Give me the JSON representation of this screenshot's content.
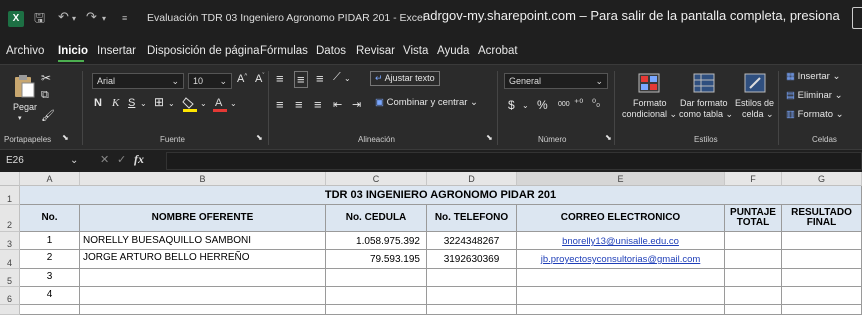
{
  "titlebar": {
    "doc_title": "Evaluación TDR 03 Ingeniero Agronomo PIDAR 201  -  Excel",
    "fullscreen_msg": "adrgov-my.sharepoint.com – Para salir de la pantalla completa, presiona"
  },
  "menu": [
    "Archivo",
    "Inicio",
    "Insertar",
    "Disposición de página",
    "Fórmulas",
    "Datos",
    "Revisar",
    "Vista",
    "Ayuda",
    "Acrobat"
  ],
  "ribbon": {
    "clipboard": {
      "paste": "Pegar",
      "label": "Portapapeles"
    },
    "font": {
      "name": "Arial",
      "size": "10",
      "label": "Fuente",
      "bold": "N",
      "italic": "K",
      "underline": "S"
    },
    "alignment": {
      "wrap": "Ajustar texto",
      "merge": "Combinar y centrar",
      "label": "Alineación"
    },
    "number": {
      "format": "General",
      "currency": "$",
      "percent": "%",
      "thousands": "000",
      "label": "Número"
    },
    "styles": {
      "conditional": "Formato",
      "conditional2": "condicional",
      "as_table": "Dar formato",
      "as_table2": "como tabla",
      "cell_styles": "Estilos de",
      "cell_styles2": "celda",
      "label": "Estilos"
    },
    "cells": {
      "insert": "Insertar",
      "delete": "Eliminar",
      "format": "Formato",
      "label": "Celdas"
    }
  },
  "formula": {
    "name_box": "E26",
    "content": ""
  },
  "columns": [
    "A",
    "B",
    "C",
    "D",
    "E",
    "F",
    "G"
  ],
  "rows": [
    "1",
    "2",
    "3",
    "4",
    "5",
    "6"
  ],
  "sheet": {
    "title": "TDR 03 INGENIERO AGRONOMO PIDAR 201",
    "headers": [
      "No.",
      "NOMBRE OFERENTE",
      "No. CEDULA",
      "No. TELEFONO",
      "CORREO ELECTRONICO",
      "PUNTAJE TOTAL",
      "RESULTADO FINAL"
    ],
    "data": [
      [
        "1",
        "NORELLY BUESAQUILLO SAMBONI",
        "1.058.975.392",
        "3224348267",
        "bnorelly13@unisalle.edu.co",
        "",
        ""
      ],
      [
        "2",
        "JORGE ARTURO BELLO HERREÑO",
        "79.593.195",
        "3192630369",
        "jb.proyectosyconsultorias@gmail.com",
        "",
        ""
      ],
      [
        "3",
        "",
        "",
        "",
        "",
        "",
        ""
      ],
      [
        "4",
        "",
        "",
        "",
        "",
        "",
        ""
      ]
    ]
  },
  "colors": {
    "accent": "#4caf50",
    "header_fill": "#dce6f1",
    "link": "#1f3fb8",
    "excel_green": "#1d7044"
  }
}
